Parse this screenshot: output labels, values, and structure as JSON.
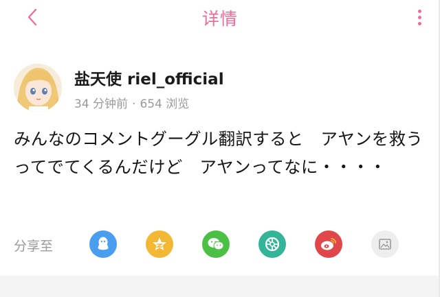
{
  "header": {
    "title": "详情",
    "back_icon": "chevron-left-icon",
    "more_icon": "more-vertical-icon",
    "accent_color": "#f06a96"
  },
  "post": {
    "author": "盐天使 riel_official",
    "time": "34 分钟前",
    "separator": "·",
    "views": "654 浏览",
    "content": "みんなのコメントグーグル翻訳すると　アヤンを救うってでてくるんだけど　アヤンってなに・・・・"
  },
  "share": {
    "label": "分享至",
    "targets": [
      {
        "name": "qq-icon",
        "color": "#4a9ef0"
      },
      {
        "name": "qzone-icon",
        "color": "#f2b833"
      },
      {
        "name": "wechat-icon",
        "color": "#4cc045"
      },
      {
        "name": "moments-icon",
        "color": "#34b59a"
      },
      {
        "name": "weibo-icon",
        "color": "#e0474a"
      },
      {
        "name": "save-image-icon",
        "color": "#eeeeee"
      }
    ]
  }
}
